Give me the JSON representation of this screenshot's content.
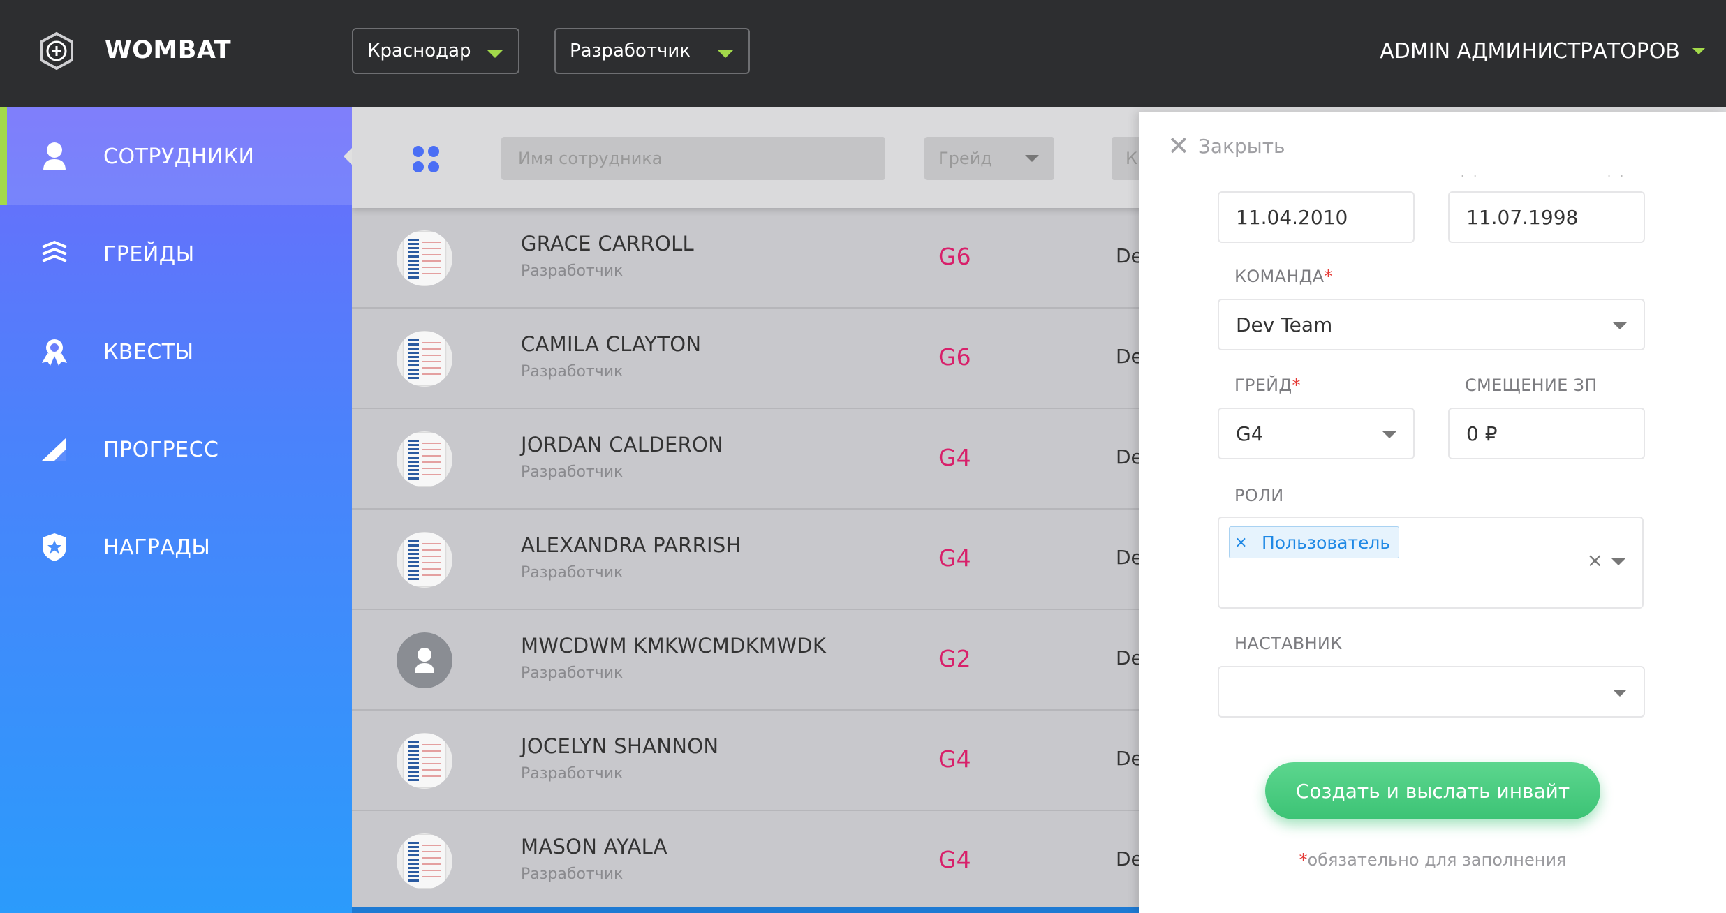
{
  "header": {
    "brand": "WOMBAT",
    "city_select": "Краснодар",
    "role_select": "Разработчик",
    "user_name": "ADMIN АДМИНИСТРАТОРОВ"
  },
  "sidebar": {
    "items": [
      {
        "label": "СОТРУДНИКИ",
        "icon": "person-icon",
        "active": true
      },
      {
        "label": "ГРЕЙДЫ",
        "icon": "layers-icon"
      },
      {
        "label": "КВЕСТЫ",
        "icon": "award-icon"
      },
      {
        "label": "ПРОГРЕСС",
        "icon": "progress-icon"
      },
      {
        "label": "НАГРАДЫ",
        "icon": "shield-star-icon"
      }
    ]
  },
  "toolbar": {
    "name_placeholder": "Имя сотрудника",
    "grade_placeholder": "Грейд",
    "cut_filter": "К"
  },
  "employees": [
    {
      "name": "GRACE CARROLL",
      "role": "Разработчик",
      "grade": "G6",
      "team": "De",
      "avatar": "doc"
    },
    {
      "name": "CAMILA CLAYTON",
      "role": "Разработчик",
      "grade": "G6",
      "team": "De",
      "avatar": "doc"
    },
    {
      "name": "JORDAN CALDERON",
      "role": "Разработчик",
      "grade": "G4",
      "team": "De",
      "avatar": "doc"
    },
    {
      "name": "ALEXANDRA PARRISH",
      "role": "Разработчик",
      "grade": "G4",
      "team": "De",
      "avatar": "doc"
    },
    {
      "name": "MWCDWM KMKWCMDKMWDK",
      "role": "Разработчик",
      "grade": "G2",
      "team": "De",
      "avatar": "person"
    },
    {
      "name": "JOCELYN SHANNON",
      "role": "Разработчик",
      "grade": "G4",
      "team": "De",
      "avatar": "doc"
    },
    {
      "name": "MASON AYALA",
      "role": "Разработчик",
      "grade": "G4",
      "team": "De",
      "avatar": "doc"
    }
  ],
  "panel": {
    "close_label": "Закрыть",
    "hire_date": "11.04.2010",
    "birth_date": "11.07.1998",
    "team_label": "КОМАНДА",
    "team_value": "Dev Team",
    "grade_label": "ГРЕЙД",
    "grade_value": "G4",
    "salary_label": "СМЕЩЕНИЕ ЗП",
    "salary_value": "0 ₽",
    "roles_label": "РОЛИ",
    "roles": [
      "Пользователь"
    ],
    "mentor_label": "НАСТАВНИК",
    "mentor_value": "",
    "submit_label": "Создать и выслать инвайт",
    "required_note": "обязательно для заполнения",
    "required_mark": "*"
  },
  "colors": {
    "accent_green": "#a3d94a",
    "grade_pink": "#d8206a",
    "submit_green": "#3cc375"
  }
}
